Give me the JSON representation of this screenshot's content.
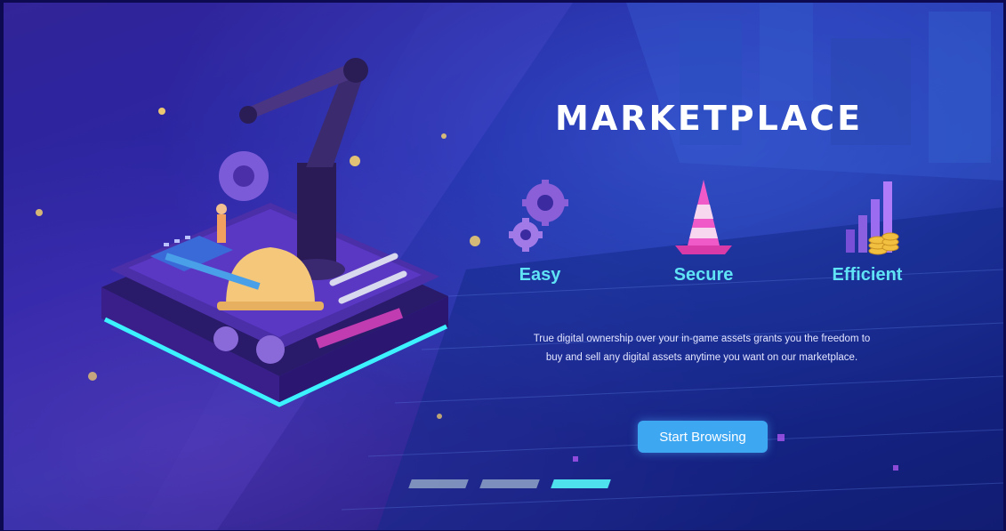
{
  "page": {
    "title": "MARKETPLACE"
  },
  "features": [
    {
      "label": "Easy",
      "icon": "gears-icon"
    },
    {
      "label": "Secure",
      "icon": "traffic-cone-icon"
    },
    {
      "label": "Efficient",
      "icon": "bar-chart-coins-icon"
    }
  ],
  "description": "True digital ownership over your in-game assets grants you the freedom to buy and sell any digital assets anytime you want on our marketplace.",
  "cta": {
    "label": "Start Browsing"
  },
  "pager": {
    "count": 3,
    "active_index": 2
  },
  "colors": {
    "accent": "#5fe3f5",
    "button": "#3ea7f2",
    "background": "#1a2c9e"
  }
}
